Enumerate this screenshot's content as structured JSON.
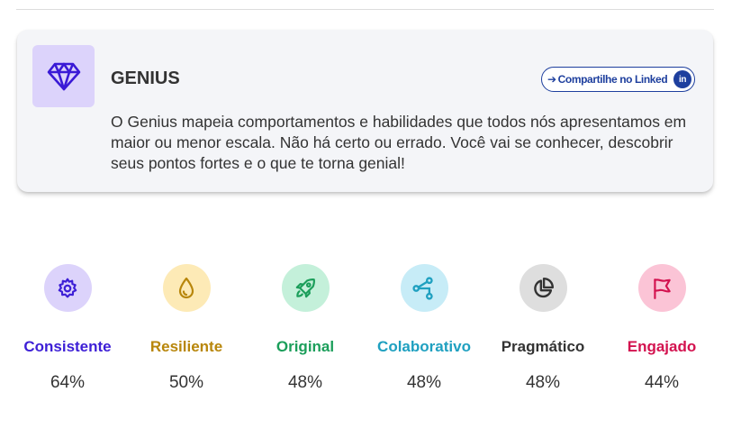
{
  "card": {
    "title": "GENIUS",
    "description": "O Genius mapeia comportamentos e habilidades que todos nós apresentamos em maior ou menor escala. Não há certo ou errado. Você vai se conhecer, descobrir seus pontos fortes e o que te torna genial!",
    "icon": "diamond-icon",
    "share_button": {
      "label": "Compartilhe no Linked",
      "badge": "in",
      "icon": "arrow-right-icon"
    }
  },
  "traits": [
    {
      "name": "Consistente",
      "percent": "64%",
      "icon": "gear-icon",
      "color": "#3d1fd6",
      "bg": "#dcd3fb"
    },
    {
      "name": "Resiliente",
      "percent": "50%",
      "icon": "drop-icon",
      "color": "#b8860b",
      "bg": "#fdeab6"
    },
    {
      "name": "Original",
      "percent": "48%",
      "icon": "rocket-icon",
      "color": "#1b9e5a",
      "bg": "#c4f0da"
    },
    {
      "name": "Colaborativo",
      "percent": "48%",
      "icon": "share-network-icon",
      "color": "#1fa0c0",
      "bg": "#c7ecf7"
    },
    {
      "name": "Pragmático",
      "percent": "48%",
      "icon": "pie-chart-icon",
      "color": "#333333",
      "bg": "#dedede"
    },
    {
      "name": "Engajado",
      "percent": "44%",
      "icon": "flag-icon",
      "color": "#d3124f",
      "bg": "#fbc4d6"
    }
  ]
}
